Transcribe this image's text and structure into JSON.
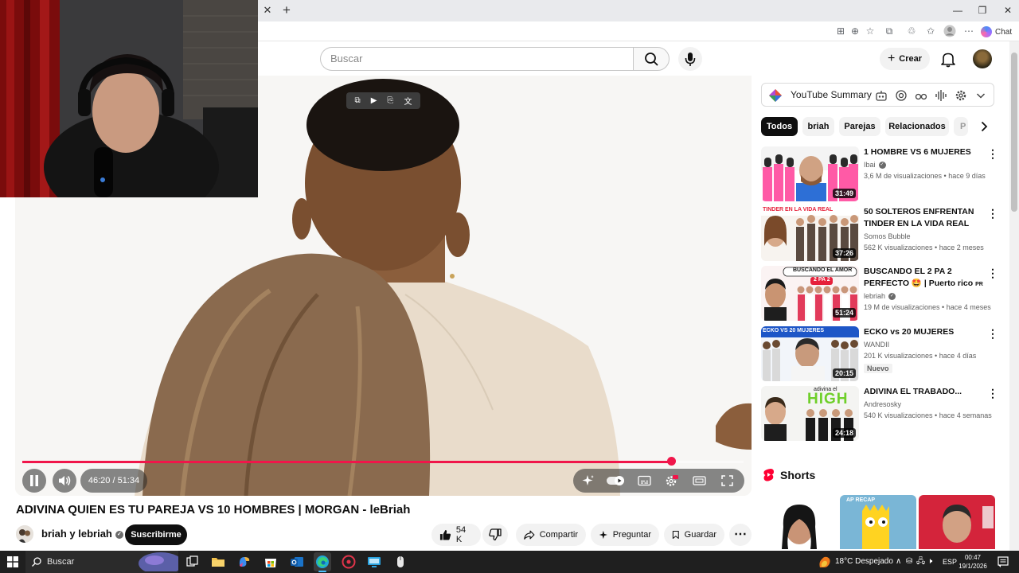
{
  "browser": {
    "tab_close": "✕",
    "new_tab": "+",
    "chat_label": "Chat"
  },
  "header": {
    "search_placeholder": "Buscar",
    "create_label": "Crear"
  },
  "player": {
    "time": "46:20 / 51:34",
    "progress": 0.899
  },
  "video": {
    "title": "ADIVINA QUIEN ES TU PAREJA VS 10 HOMBRES | MORGAN - leBriah",
    "channel": "briah y lebriah",
    "subscribe_label": "Suscribirme",
    "likes": "54 K",
    "share_label": "Compartir",
    "ask_label": "Preguntar",
    "save_label": "Guardar"
  },
  "summary_bar": {
    "label": "YouTube Summary"
  },
  "chips": [
    "Todos",
    "briah",
    "Parejas",
    "Relacionados",
    "P"
  ],
  "recommendations": [
    {
      "title": "1 HOMBRE VS 6 MUJERES",
      "channel": "Ibai",
      "verified": true,
      "meta": "3,6 M de visualizaciones • hace 9 días",
      "duration": "31:49"
    },
    {
      "title": "50 SOLTEROS ENFRENTAN TINDER EN LA VIDA REAL",
      "channel": "Somos Bubble",
      "verified": false,
      "meta": "562 K visualizaciones • hace 2 meses",
      "duration": "37:26"
    },
    {
      "title": "BUSCANDO EL 2 PA 2 PERFECTO 🤩 | Puerto rico",
      "title_tag": "PR",
      "channel": "lebriah",
      "verified": true,
      "meta": "19 M de visualizaciones • hace 4 meses",
      "duration": "51:24"
    },
    {
      "title": "ECKO vs 20 MUJERES",
      "channel": "WANDII",
      "verified": false,
      "meta": "201 K visualizaciones • hace 4 días",
      "badge": "Nuevo",
      "duration": "20:15"
    },
    {
      "title": "ADIVINA EL TRABADO...",
      "channel": "Andresosky",
      "verified": false,
      "meta": "540 K visualizaciones • hace 4 semanas",
      "duration": "24:18"
    }
  ],
  "thumb_text": {
    "t2_top": "TINDER EN LA VIDA REAL",
    "t3_top": "BUSCANDO EL AMOR",
    "t3_sub": "2 PA 2",
    "t4_top": "ECKO VS 20 MUJERES",
    "t5_top": "adivina el",
    "t5_big": "HIGH",
    "short1_text": "AP RECAP"
  },
  "shorts": {
    "title": "Shorts"
  },
  "taskbar": {
    "search_label": "Buscar",
    "weather": "18°C  Despejado",
    "lang": "ESP",
    "time": "00:47",
    "date": "19/1/2026"
  },
  "colors": {
    "progress": "#f0164a",
    "subscribe_bg": "#0f0f0f",
    "shorts_logo": "#ff0033"
  }
}
